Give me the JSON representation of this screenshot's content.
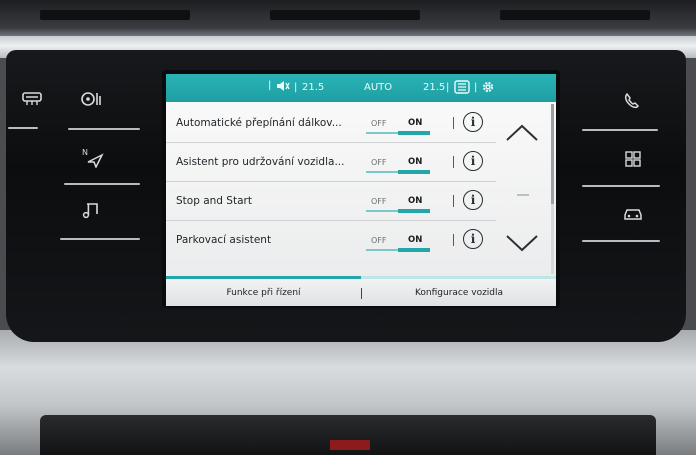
{
  "status_bar": {
    "mute_icon": "speaker-muted-icon",
    "left_temp": "21.5",
    "mode": "AUTO",
    "right_temp": "21.5",
    "seat_icon": "seat-heat-icon",
    "gear_icon": "gear-icon",
    "accent_color": "#22a6aa"
  },
  "settings": [
    {
      "label": "Automatické přepínání dálkov...",
      "off": "OFF",
      "on": "ON",
      "state": "ON"
    },
    {
      "label": "Asistent pro udržování vozidla...",
      "off": "OFF",
      "on": "ON",
      "state": "ON"
    },
    {
      "label": "Stop and Start",
      "off": "OFF",
      "on": "ON",
      "state": "ON"
    },
    {
      "label": "Parkovací asistent",
      "off": "OFF",
      "on": "ON",
      "state": "ON"
    }
  ],
  "info_glyph": "i",
  "tabs": [
    {
      "label": "Funkce při řízení",
      "active": true
    },
    {
      "label": "Konfigurace vozidla",
      "active": false
    }
  ],
  "left_keys": [
    "rear-defrost-icon",
    "fan-climate-icon",
    "navigation-icon",
    "music-icon"
  ],
  "right_keys": [
    "phone-icon",
    "apps-grid-icon",
    "car-icon"
  ]
}
